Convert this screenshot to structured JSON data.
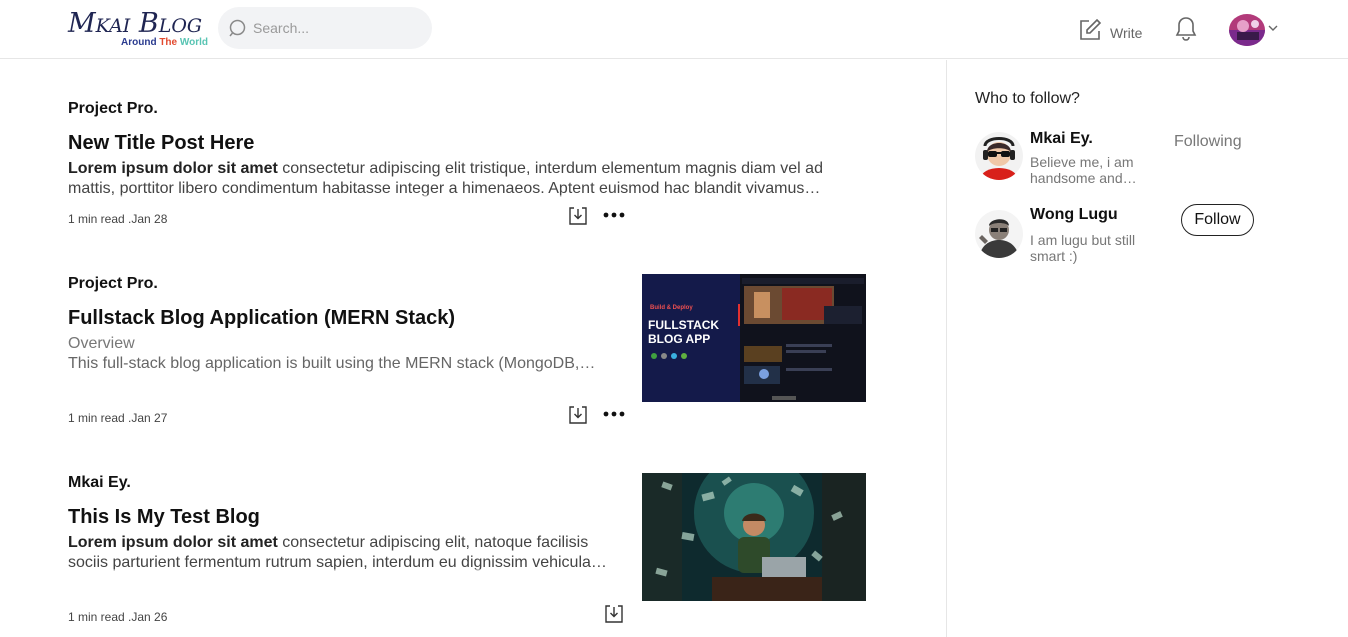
{
  "header": {
    "logo_title": "Mkai Blog",
    "logo_sub_1": "Around",
    "logo_sub_2": "The",
    "logo_sub_3": "World",
    "search_placeholder": "Search...",
    "write_label": "Write"
  },
  "posts": [
    {
      "author": "Project Pro.",
      "title": "New Title Post Here",
      "excerpt_bold": "Lorem ipsum dolor sit amet",
      "excerpt_rest": " consectetur adipiscing elit tristique, interdum elementum magnis diam vel ad mattis, porttitor libero condimentum habitasse integer a himenaeos. Aptent euismod hac blandit vivamus…",
      "meta": "1 min read .Jan 28"
    },
    {
      "author": "Project Pro.",
      "title": "Fullstack Blog Application (MERN Stack)",
      "excerpt_sub": "Overview",
      "excerpt_rest": "This full-stack blog application is built using the MERN stack (MongoDB,…",
      "meta": "1 min read .Jan 27",
      "thumb_caption_small": "Build & Deploy",
      "thumb_caption_1": "FULLSTACK",
      "thumb_caption_2": "BLOG APP"
    },
    {
      "author": "Mkai Ey.",
      "title": "This Is My Test Blog",
      "excerpt_bold": "Lorem ipsum dolor sit amet",
      "excerpt_rest": " consectetur adipiscing elit, natoque facilisis sociis parturient fermentum rutrum sapien, interdum eu dignissim vehicula…",
      "meta": "1 min read .Jan 26"
    }
  ],
  "sidebar": {
    "heading": "Who to follow?",
    "people": [
      {
        "name": "Mkai Ey.",
        "bio": "Believe me, i am handsome and…",
        "status": "Following"
      },
      {
        "name": "Wong Lugu",
        "bio": "I am lugu but still smart :)",
        "button": "Follow"
      }
    ]
  }
}
